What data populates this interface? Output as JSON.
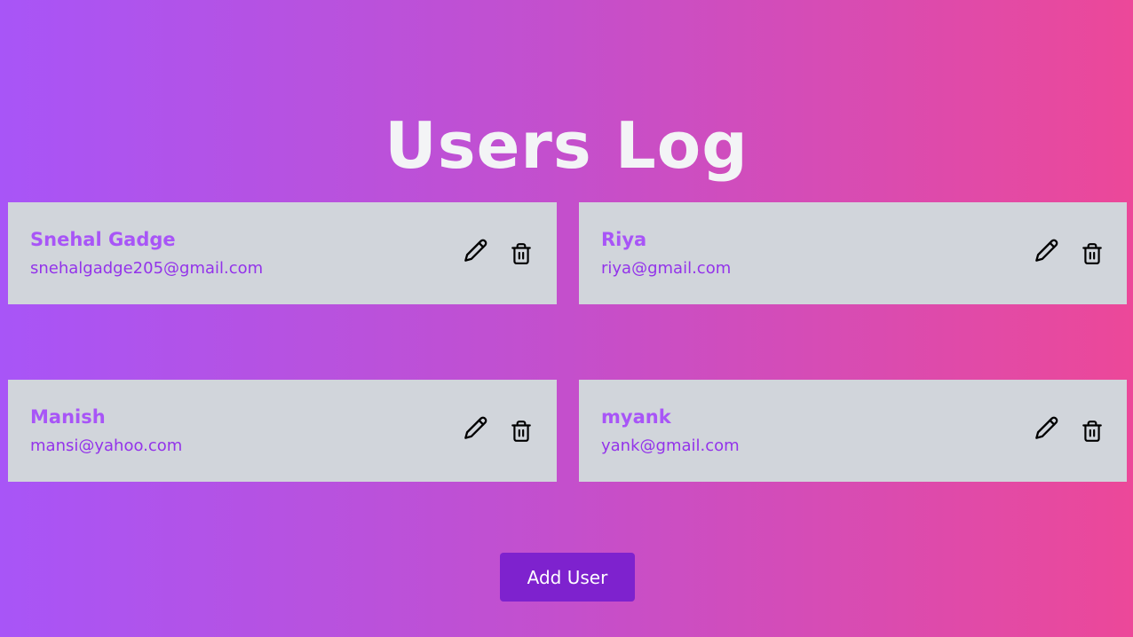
{
  "page": {
    "title": "Users Log"
  },
  "users": [
    {
      "name": "Snehal Gadge",
      "email": "snehalgadge205@gmail.com"
    },
    {
      "name": "Riya",
      "email": "riya@gmail.com"
    },
    {
      "name": "Manish",
      "email": "mansi@yahoo.com"
    },
    {
      "name": "myank",
      "email": "yank@gmail.com"
    }
  ],
  "actions": {
    "edit_icon": "pencil-icon",
    "delete_icon": "trash-icon",
    "add_user_label": "Add User"
  },
  "colors": {
    "gradient_start": "#a855f7",
    "gradient_end": "#ec4899",
    "card_bg": "#d1d5db",
    "name_color": "#a855f7",
    "email_color": "#9333ea",
    "button_bg": "#7e22ce"
  }
}
